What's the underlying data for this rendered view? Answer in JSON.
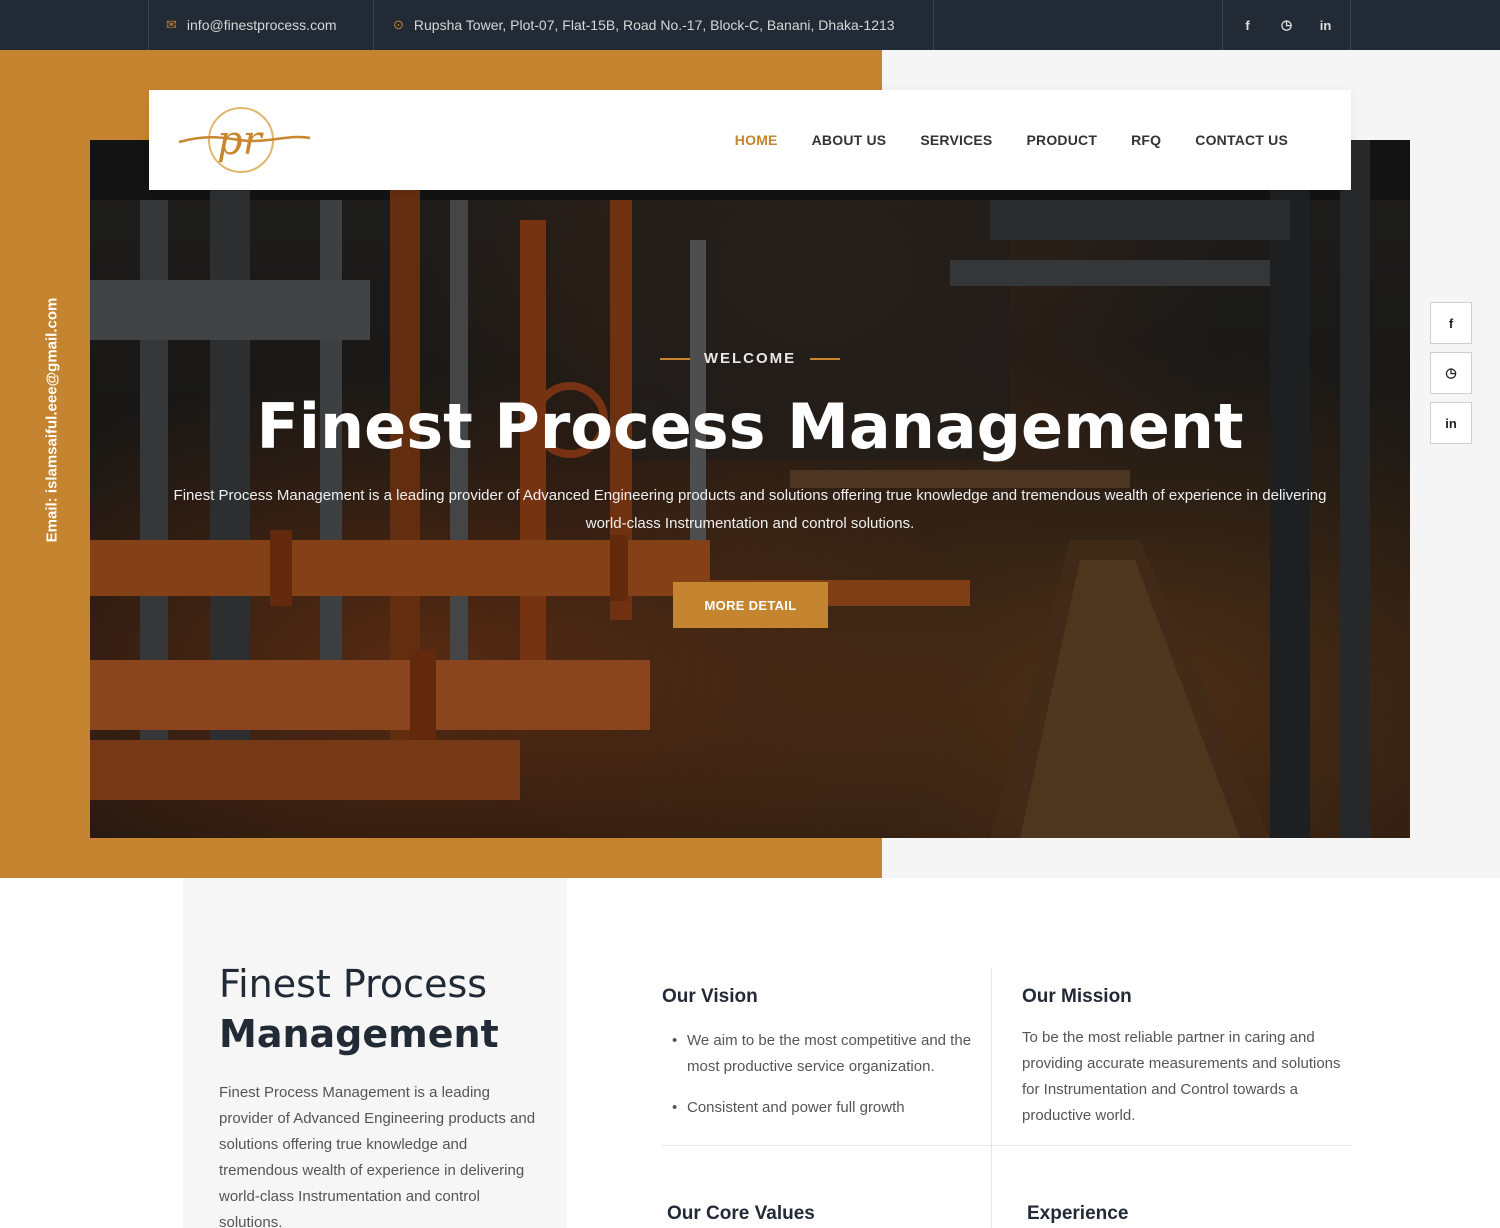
{
  "topbar": {
    "email_icon": "envelope-icon",
    "email": "info@finestprocess.com",
    "address_icon": "map-pin-icon",
    "address": "Rupsha Tower, Plot-07, Flat-15B, Road No.-17, Block-C, Banani, Dhaka-1213",
    "social": [
      {
        "icon": "facebook-icon",
        "glyph": "f"
      },
      {
        "icon": "whatsapp-icon",
        "glyph": "◷"
      },
      {
        "icon": "linkedin-icon",
        "glyph": "in"
      }
    ]
  },
  "sidebar": {
    "vertical_email": "Email: islamsaiful.eee@gmail.com"
  },
  "header": {
    "logo_text": "pr",
    "nav": [
      {
        "label": "HOME",
        "active": true
      },
      {
        "label": "ABOUT US",
        "active": false
      },
      {
        "label": "SERVICES",
        "active": false
      },
      {
        "label": "PRODUCT",
        "active": false
      },
      {
        "label": "RFQ",
        "active": false
      },
      {
        "label": "CONTACT US",
        "active": false
      }
    ]
  },
  "hero": {
    "kicker": "WELCOME",
    "title": "Finest Process Management",
    "description": "Finest Process Management is a leading provider of Advanced Engineering products and solutions offering true knowledge and tremendous wealth of experience in delivering world-class Instrumentation and control solutions.",
    "button": "MORE DETAIL"
  },
  "side_social": [
    {
      "icon": "facebook-icon",
      "glyph": "f"
    },
    {
      "icon": "whatsapp-icon",
      "glyph": "◷"
    },
    {
      "icon": "linkedin-icon",
      "glyph": "in"
    }
  ],
  "intro": {
    "title_light": "Finest Process",
    "title_bold": "Management",
    "description": "Finest Process Management is a leading provider of Advanced Engineering products and solutions offering true knowledge and tremendous wealth of experience in delivering world-class Instrumentation and control solutions."
  },
  "vision": {
    "title": "Our Vision",
    "items": [
      "We aim to be the most competitive and the most productive service organization.",
      "Consistent and power full growth"
    ]
  },
  "mission": {
    "title": "Our Mission",
    "text": "To be the most reliable partner in caring and providing accurate measurements and solutions for Instrumentation and Control towards a productive world."
  },
  "core_values": {
    "title": "Our Core Values"
  },
  "experience": {
    "title": "Experience"
  },
  "colors": {
    "accent": "#c5842f",
    "topbar_bg": "#222a35",
    "dark_text": "#222a35"
  }
}
